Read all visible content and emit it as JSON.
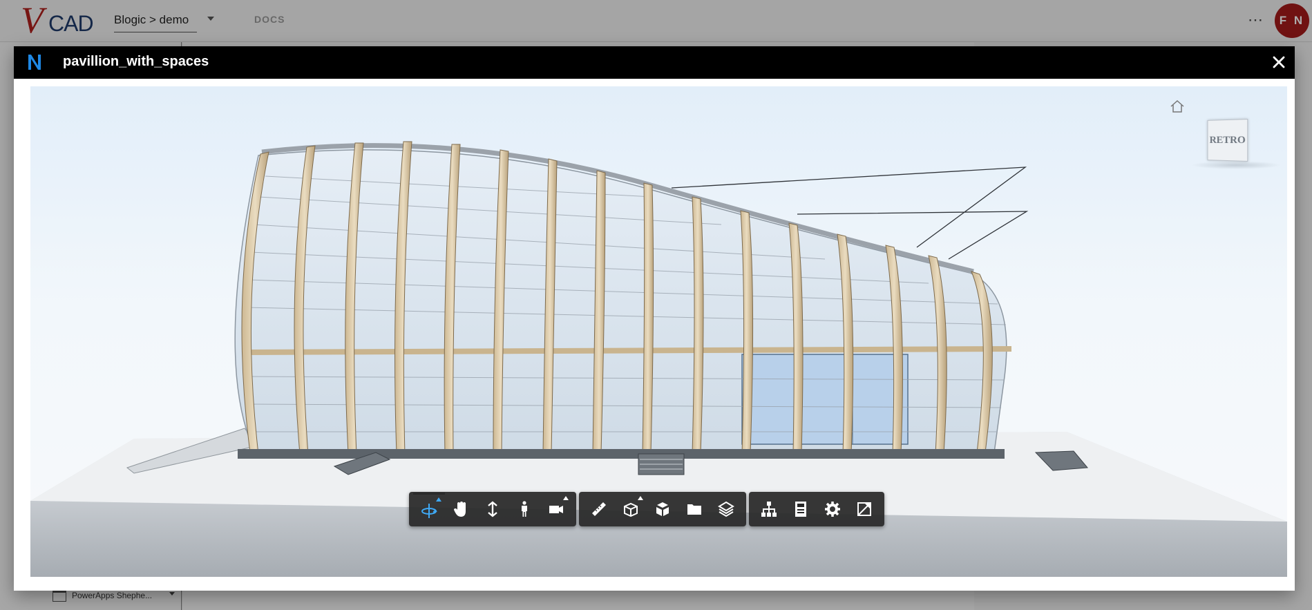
{
  "app": {
    "logo_v": "V",
    "logo_cad": "CAD",
    "project": "Blogic > demo",
    "docs_label": "DOCS",
    "avatar_initials": "F N",
    "bg_list_item": "PowerApps Shephe..."
  },
  "modal": {
    "title": "pavillion_with_spaces",
    "logo_letter": "N",
    "accent_color": "#1e88e5"
  },
  "viewer": {
    "viewcube_label": "RETRO"
  },
  "toolbar": {
    "groups": [
      [
        {
          "name": "orbit",
          "icon": "orbit-icon",
          "active": true,
          "submenu": true
        },
        {
          "name": "pan",
          "icon": "hand-icon",
          "active": false,
          "submenu": false
        },
        {
          "name": "zoom",
          "icon": "updown-arrow-icon",
          "active": false,
          "submenu": false
        },
        {
          "name": "first-person",
          "icon": "person-icon",
          "active": false,
          "submenu": false
        },
        {
          "name": "camera",
          "icon": "camera-icon",
          "active": false,
          "submenu": true
        }
      ],
      [
        {
          "name": "measure",
          "icon": "ruler-icon",
          "active": false,
          "submenu": false
        },
        {
          "name": "section",
          "icon": "section-box-icon",
          "active": false,
          "submenu": true
        },
        {
          "name": "explode",
          "icon": "explode-cube-icon",
          "active": false,
          "submenu": false
        },
        {
          "name": "documents",
          "icon": "folder-icon",
          "active": false,
          "submenu": false
        },
        {
          "name": "layers",
          "icon": "layers-icon",
          "active": false,
          "submenu": false
        }
      ],
      [
        {
          "name": "model-browser",
          "icon": "hierarchy-icon",
          "active": false,
          "submenu": false
        },
        {
          "name": "properties",
          "icon": "properties-icon",
          "active": false,
          "submenu": false
        },
        {
          "name": "settings",
          "icon": "gear-icon",
          "active": false,
          "submenu": false
        },
        {
          "name": "fullscreen",
          "icon": "fullscreen-icon",
          "active": false,
          "submenu": false
        }
      ]
    ]
  }
}
